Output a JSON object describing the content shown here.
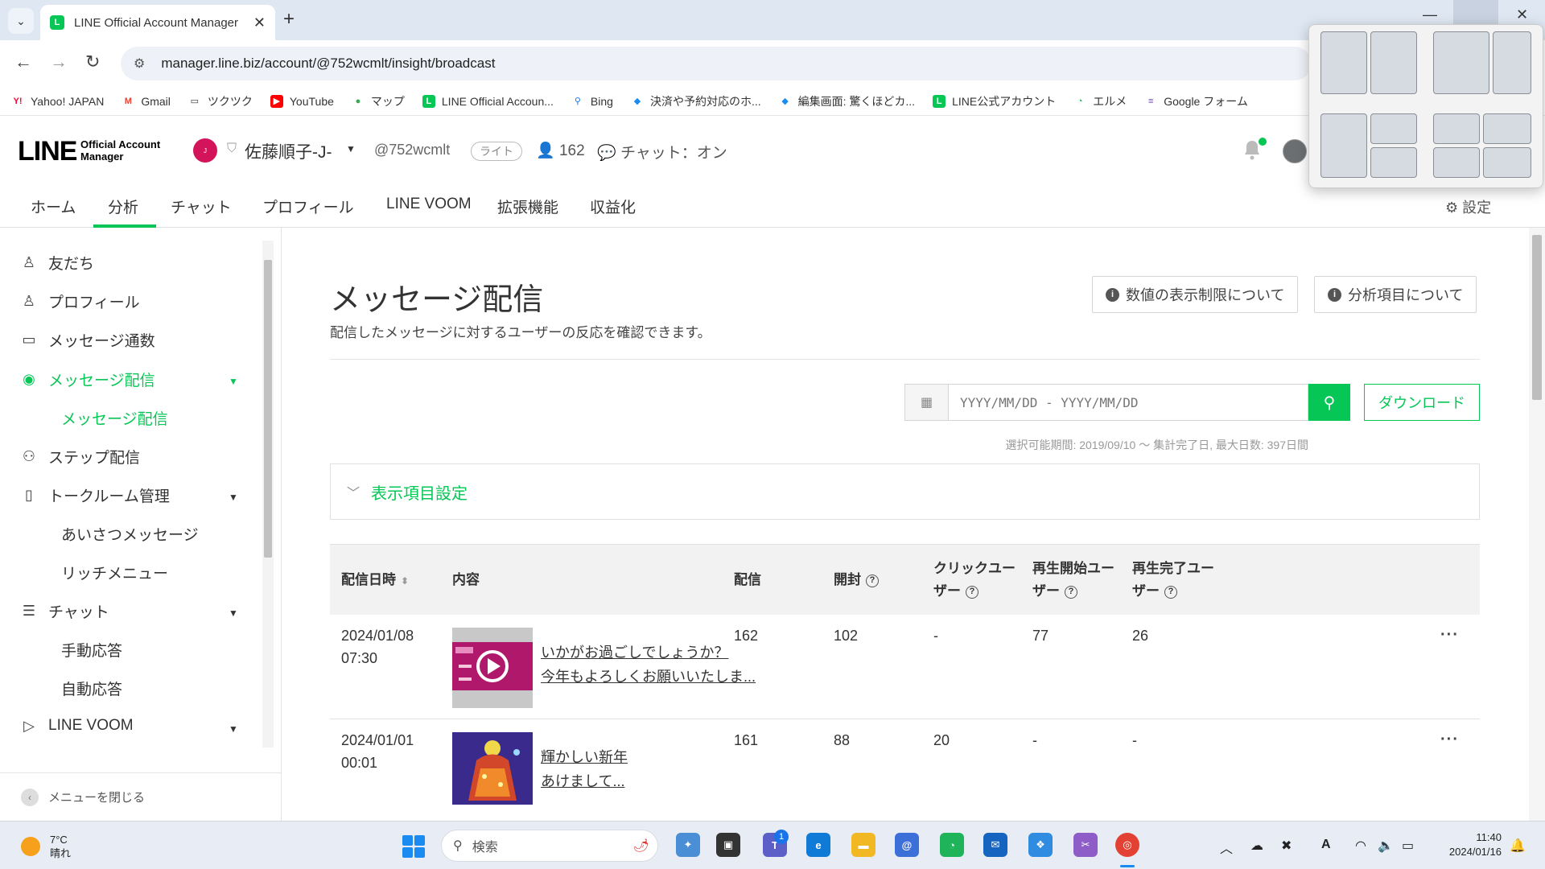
{
  "browser": {
    "tab_title": "LINE Official Account Manager",
    "url": "manager.line.biz/account/@752wcmlt/insight/broadcast",
    "bookmarks": [
      {
        "label": "Yahoo! JAPAN",
        "icon": "yahoo-icon",
        "color": "#ff0033"
      },
      {
        "label": "Gmail",
        "icon": "gmail-icon",
        "color": "#ea4335"
      },
      {
        "label": "ツクツク",
        "icon": "folder-icon",
        "color": "#333333"
      },
      {
        "label": "YouTube",
        "icon": "youtube-icon",
        "color": "#ff0000"
      },
      {
        "label": "マップ",
        "icon": "map-pin-icon",
        "color": "#34a853"
      },
      {
        "label": "LINE Official Accoun...",
        "icon": "line-icon",
        "color": "#06c755"
      },
      {
        "label": "Bing",
        "icon": "search-icon",
        "color": "#1a73e8"
      },
      {
        "label": "決済や予約対応のホ...",
        "icon": "pin-icon",
        "color": "#1a8bf0"
      },
      {
        "label": "編集画面: 驚くほどカ...",
        "icon": "pin-icon",
        "color": "#1a8bf0"
      },
      {
        "label": "LINE公式アカウント",
        "icon": "line-icon",
        "color": "#06c755"
      },
      {
        "label": "エルメ",
        "icon": "elme-icon",
        "color": "#1fb35a"
      },
      {
        "label": "Google フォーム",
        "icon": "forms-icon",
        "color": "#7248b9"
      }
    ]
  },
  "header": {
    "logo_main": "LINE",
    "logo_sub_1": "Official Account",
    "logo_sub_2": "Manager",
    "account_name": "佐藤順子-J-",
    "account_id": "@752wcmlt",
    "plan": "ライト",
    "friends_count": "162",
    "chat_status": "チャット：オン"
  },
  "nav": {
    "items": [
      "ホーム",
      "分析",
      "チャット",
      "プロフィール",
      "LINE VOOM",
      "拡張機能",
      "収益化"
    ],
    "active": "分析",
    "settings": "設定"
  },
  "sidebar": {
    "friends": "友だち",
    "profile": "プロフィール",
    "msg_count": "メッセージ通数",
    "broadcast": "メッセージ配信",
    "broadcast_sub": "メッセージ配信",
    "step": "ステップ配信",
    "talkroom": "トークルーム管理",
    "greeting": "あいさつメッセージ",
    "rich_menu": "リッチメニュー",
    "chat": "チャット",
    "manual": "手動応答",
    "auto": "自動応答",
    "voom": "LINE VOOM",
    "close_menu": "メニューを閉じる"
  },
  "main": {
    "title": "メッセージ配信",
    "description": "配信したメッセージに対するユーザーの反応を確認できます。",
    "btn_limits": "数値の表示制限について",
    "btn_items": "分析項目について",
    "date_placeholder": "YYYY/MM/DD - YYYY/MM/DD",
    "download": "ダウンロード",
    "range_note": "選択可能期間: 2019/09/10 〜 集計完了日, 最大日数: 397日間",
    "display_settings": "表示項目設定"
  },
  "table": {
    "headers": {
      "date": "配信日時",
      "content": "内容",
      "delivered": "配信",
      "opened": "開封",
      "click_1": "クリックユー",
      "click_2": "ザー",
      "play_start_1": "再生開始ユー",
      "play_start_2": "ザー",
      "play_done_1": "再生完了ユー",
      "play_done_2": "ザー"
    },
    "rows": [
      {
        "date": "2024/01/08",
        "time": "07:30",
        "line1": "いかがお過ごしでしょうか？",
        "line2": "今年もよろしくお願いいたしま...",
        "delivered": "162",
        "opened": "102",
        "click": "-",
        "play_start": "77",
        "play_done": "26"
      },
      {
        "date": "2024/01/01",
        "time": "00:01",
        "line1": "輝かしい新年",
        "line2": "あけまして...",
        "delivered": "161",
        "opened": "88",
        "click": "20",
        "play_start": "-",
        "play_done": "-"
      }
    ]
  },
  "taskbar": {
    "temp": "7°C",
    "weather": "晴れ",
    "search": "検索",
    "time": "11:40",
    "date": "2024/01/16",
    "badge": "1"
  }
}
